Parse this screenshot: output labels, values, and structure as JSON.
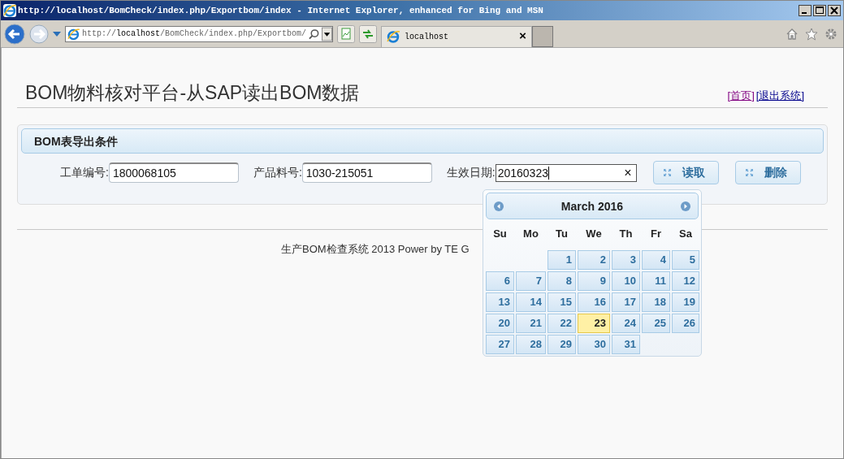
{
  "window": {
    "title": "http://localhost/BomCheck/index.php/Exportbom/index - Internet Explorer, enhanced for Bing and MSN"
  },
  "browser": {
    "address": "http://**localhost**/BomCheck/index.php/Exportbom/",
    "tabs": [
      {
        "label": "localhost",
        "selected": true,
        "close": "×"
      }
    ]
  },
  "page": {
    "heading": "BOM物料核对平台-从SAP读出BOM数据",
    "links": [
      {
        "label": "[首页]",
        "visited": true
      },
      {
        "label": "[退出系统]",
        "visited": false
      }
    ],
    "panel": {
      "title": "BOM表导出条件",
      "fields": [
        {
          "label": "工单编号:",
          "value": "1800068105",
          "focused": false
        },
        {
          "label": "产品料号:",
          "value": "1030-215051",
          "focused": false
        },
        {
          "label": "生效日期:",
          "value": "20160323",
          "focused": true,
          "clear": "×"
        }
      ],
      "buttons": [
        "读取",
        "删除"
      ]
    },
    "footer": "生产BOM检查系统 2013 Power by TE G"
  },
  "datepicker": {
    "title": "March 2016",
    "weekdays": [
      "Su",
      "Mo",
      "Tu",
      "We",
      "Th",
      "Fr",
      "Sa"
    ],
    "weeks": [
      [
        {
          "kind": "empty"
        },
        {
          "kind": "empty"
        },
        {
          "kind": "day",
          "label": "1",
          "selected": false
        },
        {
          "kind": "day",
          "label": "2",
          "selected": false
        },
        {
          "kind": "day",
          "label": "3",
          "selected": false
        },
        {
          "kind": "day",
          "label": "4",
          "selected": false
        },
        {
          "kind": "day",
          "label": "5",
          "selected": false
        }
      ],
      [
        {
          "kind": "day",
          "label": "6",
          "selected": false
        },
        {
          "kind": "day",
          "label": "7",
          "selected": false
        },
        {
          "kind": "day",
          "label": "8",
          "selected": false
        },
        {
          "kind": "day",
          "label": "9",
          "selected": false
        },
        {
          "kind": "day",
          "label": "10",
          "selected": false
        },
        {
          "kind": "day",
          "label": "11",
          "selected": false
        },
        {
          "kind": "day",
          "label": "12",
          "selected": false
        }
      ],
      [
        {
          "kind": "day",
          "label": "13",
          "selected": false
        },
        {
          "kind": "day",
          "label": "14",
          "selected": false
        },
        {
          "kind": "day",
          "label": "15",
          "selected": false
        },
        {
          "kind": "day",
          "label": "16",
          "selected": false
        },
        {
          "kind": "day",
          "label": "17",
          "selected": false
        },
        {
          "kind": "day",
          "label": "18",
          "selected": false
        },
        {
          "kind": "day",
          "label": "19",
          "selected": false
        }
      ],
      [
        {
          "kind": "day",
          "label": "20",
          "selected": false
        },
        {
          "kind": "day",
          "label": "21",
          "selected": false
        },
        {
          "kind": "day",
          "label": "22",
          "selected": false
        },
        {
          "kind": "day",
          "label": "23",
          "selected": true
        },
        {
          "kind": "day",
          "label": "24",
          "selected": false
        },
        {
          "kind": "day",
          "label": "25",
          "selected": false
        },
        {
          "kind": "day",
          "label": "26",
          "selected": false
        }
      ],
      [
        {
          "kind": "day",
          "label": "27",
          "selected": false
        },
        {
          "kind": "day",
          "label": "28",
          "selected": false
        },
        {
          "kind": "day",
          "label": "29",
          "selected": false
        },
        {
          "kind": "day",
          "label": "30",
          "selected": false
        },
        {
          "kind": "day",
          "label": "31",
          "selected": false
        },
        {
          "kind": "empty"
        },
        {
          "kind": "empty"
        }
      ]
    ]
  }
}
